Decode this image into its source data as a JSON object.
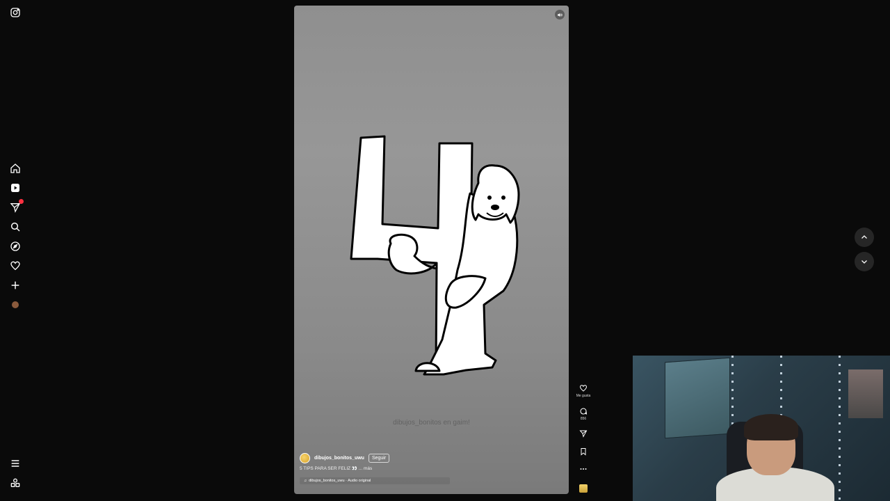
{
  "sidebar": {
    "items": [
      {
        "name": "instagram-logo-icon",
        "label": ""
      },
      {
        "name": "home-icon",
        "label": ""
      },
      {
        "name": "reels-icon",
        "label": ""
      },
      {
        "name": "messages-icon",
        "label": ""
      },
      {
        "name": "search-icon",
        "label": ""
      },
      {
        "name": "explore-icon",
        "label": ""
      },
      {
        "name": "notifications-icon",
        "label": ""
      },
      {
        "name": "create-icon",
        "label": ""
      },
      {
        "name": "profile-avatar",
        "label": ""
      },
      {
        "name": "more-menu-icon",
        "label": ""
      },
      {
        "name": "threads-icon",
        "label": ""
      }
    ],
    "messages_badge": "1"
  },
  "reel": {
    "watermark": "dibujos_bonitos en gaim!",
    "username": "dibujos_bonitos_uwu",
    "follow_label": "Seguir",
    "caption": "5 TIPS PARA SER FELIZ 👀 ... más",
    "audio": "dibujos_bonitos_uwu · Audio original"
  },
  "actions": {
    "like_label": "Me gusta",
    "comments_count": "856"
  },
  "colors": {
    "background": "#0a0a0a",
    "reel_gray": "#8f8f8f",
    "badge_red": "#ff3040"
  }
}
